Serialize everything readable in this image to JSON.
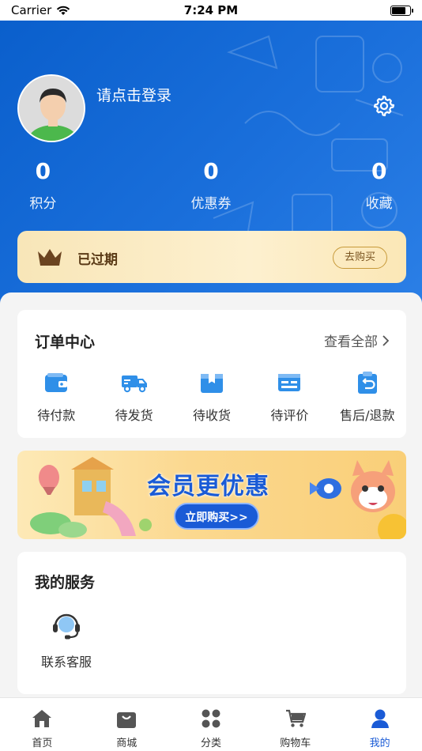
{
  "status_bar": {
    "carrier": "Carrier",
    "time": "7:24 PM"
  },
  "profile": {
    "login_prompt": "请点击登录"
  },
  "stats": [
    {
      "value": "0",
      "label": "积分"
    },
    {
      "value": "0",
      "label": "优惠券"
    },
    {
      "value": "0",
      "label": "收藏"
    }
  ],
  "vip": {
    "status": "已过期",
    "buy_label": "去购买"
  },
  "orders": {
    "title": "订单中心",
    "view_all": "查看全部",
    "items": [
      {
        "label": "待付款",
        "icon": "wallet-icon"
      },
      {
        "label": "待发货",
        "icon": "truck-icon"
      },
      {
        "label": "待收货",
        "icon": "package-icon"
      },
      {
        "label": "待评价",
        "icon": "review-icon"
      },
      {
        "label": "售后/退款",
        "icon": "refund-icon"
      }
    ]
  },
  "banner": {
    "title": "会员更优惠",
    "button": "立即购买>>"
  },
  "services": {
    "title": "我的服务",
    "items": [
      {
        "label": "联系客服",
        "icon": "headset-icon"
      }
    ]
  },
  "tabbar": [
    {
      "label": "首页",
      "icon": "home-icon",
      "active": false
    },
    {
      "label": "商城",
      "icon": "bag-icon",
      "active": false
    },
    {
      "label": "分类",
      "icon": "grid-icon",
      "active": false
    },
    {
      "label": "购物车",
      "icon": "cart-icon",
      "active": false
    },
    {
      "label": "我的",
      "icon": "user-icon",
      "active": true
    }
  ],
  "colors": {
    "accent": "#1a5bd6",
    "header": "#1a6fdb",
    "vip_gold": "#fdf0cf",
    "icon_blue": "#2f8fe8"
  }
}
